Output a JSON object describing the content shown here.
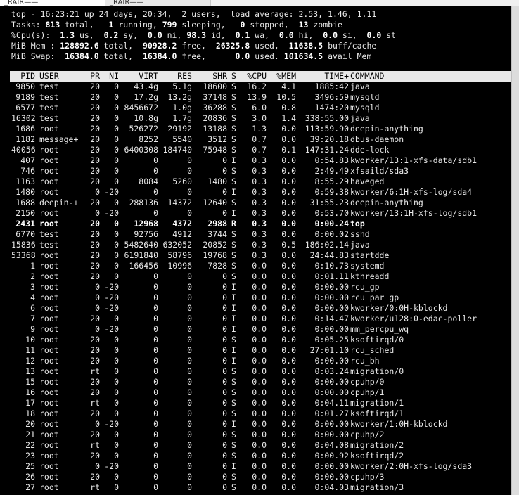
{
  "window": {
    "tabs": [
      {
        "label": "_RAIR——"
      },
      {
        "label": "_RAIR——"
      }
    ]
  },
  "top": {
    "summary": [
      [
        {
          "t": "top - 16:23:21 up 24 days, 20:34,  2 users,  load average: 2.53, 1.46, 1.11"
        }
      ],
      [
        {
          "t": "Tasks: "
        },
        {
          "t": "813",
          "b": true
        },
        {
          "t": " total,   "
        },
        {
          "t": "1",
          "b": true
        },
        {
          "t": " running, "
        },
        {
          "t": "799",
          "b": true
        },
        {
          "t": " sleeping,   "
        },
        {
          "t": "0",
          "b": true
        },
        {
          "t": " stopped,  "
        },
        {
          "t": "13",
          "b": true
        },
        {
          "t": " zombie"
        }
      ],
      [
        {
          "t": "%Cpu(s):  "
        },
        {
          "t": "1.3",
          "b": true
        },
        {
          "t": " us,  "
        },
        {
          "t": "0.2",
          "b": true
        },
        {
          "t": " sy,  "
        },
        {
          "t": "0.0",
          "b": true
        },
        {
          "t": " ni, "
        },
        {
          "t": "98.3",
          "b": true
        },
        {
          "t": " id,  "
        },
        {
          "t": "0.1",
          "b": true
        },
        {
          "t": " wa,  "
        },
        {
          "t": "0.0",
          "b": true
        },
        {
          "t": " hi,  "
        },
        {
          "t": "0.0",
          "b": true
        },
        {
          "t": " si,  "
        },
        {
          "t": "0.0",
          "b": true
        },
        {
          "t": " st"
        }
      ],
      [
        {
          "t": "MiB Mem : "
        },
        {
          "t": "128892.6",
          "b": true
        },
        {
          "t": " total,  "
        },
        {
          "t": "90928.2",
          "b": true
        },
        {
          "t": " free,  "
        },
        {
          "t": "26325.8",
          "b": true
        },
        {
          "t": " used,  "
        },
        {
          "t": "11638.5",
          "b": true
        },
        {
          "t": " buff/cache"
        }
      ],
      [
        {
          "t": "MiB Swap: "
        },
        {
          "t": " 16384.0",
          "b": true
        },
        {
          "t": " total,  "
        },
        {
          "t": "16384.0",
          "b": true
        },
        {
          "t": " free,      "
        },
        {
          "t": "0.0",
          "b": true
        },
        {
          "t": " used. "
        },
        {
          "t": "101634.5",
          "b": true
        },
        {
          "t": " avail Mem"
        }
      ]
    ],
    "columns": [
      "PID",
      "USER",
      "PR",
      "NI",
      "VIRT",
      "RES",
      "SHR",
      "S",
      "%CPU",
      "%MEM",
      "TIME+",
      "COMMAND"
    ],
    "processes": [
      [
        "9850",
        "test",
        "20",
        "0",
        "43.4g",
        "5.1g",
        "18600",
        "S",
        "16.2",
        "4.1",
        "1885:42",
        "java"
      ],
      [
        "9189",
        "test",
        "20",
        "0",
        "17.2g",
        "13.2g",
        "37148",
        "S",
        "13.9",
        "10.5",
        "3496:59",
        "mysqld"
      ],
      [
        "6577",
        "test",
        "20",
        "0",
        "8456672",
        "1.0g",
        "36288",
        "S",
        "6.0",
        "0.8",
        "1474:20",
        "mysqld"
      ],
      [
        "16302",
        "test",
        "20",
        "0",
        "10.8g",
        "1.7g",
        "20836",
        "S",
        "3.0",
        "1.4",
        "338:55.00",
        "java"
      ],
      [
        "1686",
        "root",
        "20",
        "0",
        "526272",
        "29192",
        "13188",
        "S",
        "1.3",
        "0.0",
        "113:59.90",
        "deepin-anything"
      ],
      [
        "1182",
        "message+",
        "20",
        "0",
        "8252",
        "5540",
        "3512",
        "S",
        "0.7",
        "0.0",
        "39:20.18",
        "dbus-daemon"
      ],
      [
        "40056",
        "root",
        "20",
        "0",
        "6400308",
        "184740",
        "75948",
        "S",
        "0.7",
        "0.1",
        "147:31.24",
        "dde-lock"
      ],
      [
        "407",
        "root",
        "20",
        "0",
        "0",
        "0",
        "0",
        "I",
        "0.3",
        "0.0",
        "0:54.83",
        "kworker/13:1-xfs-data/sdb1"
      ],
      [
        "746",
        "root",
        "20",
        "0",
        "0",
        "0",
        "0",
        "S",
        "0.3",
        "0.0",
        "2:49.49",
        "xfsaild/sda3"
      ],
      [
        "1163",
        "root",
        "20",
        "0",
        "8084",
        "5260",
        "1480",
        "S",
        "0.3",
        "0.0",
        "8:55.29",
        "haveged"
      ],
      [
        "1480",
        "root",
        "0",
        "-20",
        "0",
        "0",
        "0",
        "I",
        "0.3",
        "0.0",
        "0:59.38",
        "kworker/6:1H-xfs-log/sda4"
      ],
      [
        "1688",
        "deepin-+",
        "20",
        "0",
        "288136",
        "14372",
        "12640",
        "S",
        "0.3",
        "0.0",
        "31:55.23",
        "deepin-anything"
      ],
      [
        "2150",
        "root",
        "0",
        "-20",
        "0",
        "0",
        "0",
        "I",
        "0.3",
        "0.0",
        "0:53.70",
        "kworker/13:1H-xfs-log/sdb1"
      ],
      [
        "2431",
        "root",
        "20",
        "0",
        "12968",
        "4372",
        "2988",
        "R",
        "0.3",
        "0.0",
        "0:00.24",
        "top"
      ],
      [
        "6770",
        "test",
        "20",
        "0",
        "92756",
        "4912",
        "3744",
        "S",
        "0.3",
        "0.0",
        "0:00.02",
        "sshd"
      ],
      [
        "15836",
        "test",
        "20",
        "0",
        "5482640",
        "632052",
        "20852",
        "S",
        "0.3",
        "0.5",
        "186:02.14",
        "java"
      ],
      [
        "53368",
        "root",
        "20",
        "0",
        "6191840",
        "58796",
        "19768",
        "S",
        "0.3",
        "0.0",
        "24:44.83",
        "startdde"
      ],
      [
        "1",
        "root",
        "20",
        "0",
        "166456",
        "10996",
        "7828",
        "S",
        "0.0",
        "0.0",
        "0:10.73",
        "systemd"
      ],
      [
        "2",
        "root",
        "20",
        "0",
        "0",
        "0",
        "0",
        "S",
        "0.0",
        "0.0",
        "0:01.11",
        "kthreadd"
      ],
      [
        "3",
        "root",
        "0",
        "-20",
        "0",
        "0",
        "0",
        "I",
        "0.0",
        "0.0",
        "0:00.00",
        "rcu_gp"
      ],
      [
        "4",
        "root",
        "0",
        "-20",
        "0",
        "0",
        "0",
        "I",
        "0.0",
        "0.0",
        "0:00.00",
        "rcu_par_gp"
      ],
      [
        "6",
        "root",
        "0",
        "-20",
        "0",
        "0",
        "0",
        "I",
        "0.0",
        "0.0",
        "0:00.00",
        "kworker/0:0H-kblockd"
      ],
      [
        "7",
        "root",
        "20",
        "0",
        "0",
        "0",
        "0",
        "I",
        "0.0",
        "0.0",
        "0:14.47",
        "kworker/u128:0-edac-poller"
      ],
      [
        "9",
        "root",
        "0",
        "-20",
        "0",
        "0",
        "0",
        "I",
        "0.0",
        "0.0",
        "0:00.00",
        "mm_percpu_wq"
      ],
      [
        "10",
        "root",
        "20",
        "0",
        "0",
        "0",
        "0",
        "S",
        "0.0",
        "0.0",
        "0:05.25",
        "ksoftirqd/0"
      ],
      [
        "11",
        "root",
        "20",
        "0",
        "0",
        "0",
        "0",
        "I",
        "0.0",
        "0.0",
        "27:01.10",
        "rcu_sched"
      ],
      [
        "12",
        "root",
        "20",
        "0",
        "0",
        "0",
        "0",
        "I",
        "0.0",
        "0.0",
        "0:00.00",
        "rcu_bh"
      ],
      [
        "13",
        "root",
        "rt",
        "0",
        "0",
        "0",
        "0",
        "S",
        "0.0",
        "0.0",
        "0:03.24",
        "migration/0"
      ],
      [
        "15",
        "root",
        "20",
        "0",
        "0",
        "0",
        "0",
        "S",
        "0.0",
        "0.0",
        "0:00.00",
        "cpuhp/0"
      ],
      [
        "16",
        "root",
        "20",
        "0",
        "0",
        "0",
        "0",
        "S",
        "0.0",
        "0.0",
        "0:00.00",
        "cpuhp/1"
      ],
      [
        "17",
        "root",
        "rt",
        "0",
        "0",
        "0",
        "0",
        "S",
        "0.0",
        "0.0",
        "0:04.11",
        "migration/1"
      ],
      [
        "18",
        "root",
        "20",
        "0",
        "0",
        "0",
        "0",
        "S",
        "0.0",
        "0.0",
        "0:01.27",
        "ksoftirqd/1"
      ],
      [
        "20",
        "root",
        "0",
        "-20",
        "0",
        "0",
        "0",
        "I",
        "0.0",
        "0.0",
        "0:00.00",
        "kworker/1:0H-kblockd"
      ],
      [
        "21",
        "root",
        "20",
        "0",
        "0",
        "0",
        "0",
        "S",
        "0.0",
        "0.0",
        "0:00.00",
        "cpuhp/2"
      ],
      [
        "22",
        "root",
        "rt",
        "0",
        "0",
        "0",
        "0",
        "S",
        "0.0",
        "0.0",
        "0:04.08",
        "migration/2"
      ],
      [
        "23",
        "root",
        "20",
        "0",
        "0",
        "0",
        "0",
        "S",
        "0.0",
        "0.0",
        "0:00.92",
        "ksoftirqd/2"
      ],
      [
        "25",
        "root",
        "0",
        "-20",
        "0",
        "0",
        "0",
        "I",
        "0.0",
        "0.0",
        "0:00.00",
        "kworker/2:0H-xfs-log/sda3"
      ],
      [
        "26",
        "root",
        "20",
        "0",
        "0",
        "0",
        "0",
        "S",
        "0.0",
        "0.0",
        "0:00.00",
        "cpuhp/3"
      ],
      [
        "27",
        "root",
        "rt",
        "0",
        "0",
        "0",
        "0",
        "S",
        "0.0",
        "0.0",
        "0:04.03",
        "migration/3"
      ]
    ],
    "highlighted_pid": "2431"
  },
  "colors": {
    "terminal_bg": "#000000",
    "terminal_fg": "#e8e8e8",
    "header_bar_bg": "#e8e8e8",
    "header_bar_fg": "#000000"
  }
}
